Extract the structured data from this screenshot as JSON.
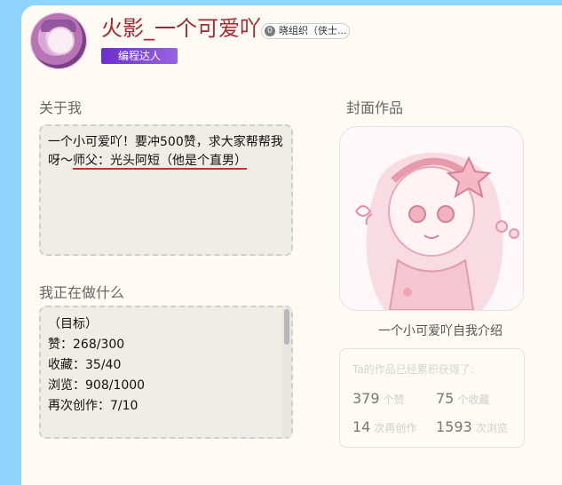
{
  "profile": {
    "username": "火影_一个可爱吖",
    "org_badge": "晓组织（侠士...",
    "org_icon": "0",
    "tag": "编程达人"
  },
  "sections": {
    "about_title": "关于我",
    "doing_title": "我正在做什么",
    "cover_title": "封面作品",
    "cover_caption": "一个小可爱吖自我介绍"
  },
  "about": {
    "text_plain": "一个小可爱吖！要冲500赞，求大家帮帮我呀～",
    "text_underlined": "师父：光头阿短（他是个直男）"
  },
  "doing": {
    "text": "（目标）\n赞：268/300\n收藏：35/40\n浏览：908/1000\n再次创作：7/10"
  },
  "stats": {
    "title": "Ta的作品已经累积获得了:",
    "likes": "379",
    "likes_unit": "个赞",
    "collects": "75",
    "collects_unit": "个收藏",
    "remix": "14",
    "remix_unit": "次再创作",
    "views": "1593",
    "views_unit": "次浏览"
  },
  "colors": {
    "background": "#8fd3ff",
    "card": "#fffaf4",
    "username": "#a62833",
    "tag_gradient_start": "#6a2dcf",
    "tag_gradient_end": "#9a63e0",
    "underline": "#cc2f2f"
  },
  "icons": [
    "avatar-image",
    "org-badge-icon",
    "cover-artwork"
  ]
}
